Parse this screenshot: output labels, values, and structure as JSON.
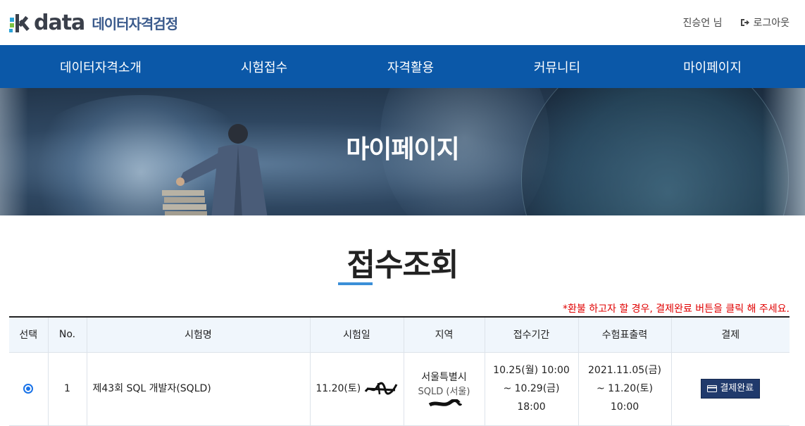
{
  "header": {
    "logo_text": "data",
    "logo_subtitle": "데이터자격검정",
    "user_name": "진승언 님",
    "logout_label": "로그아웃"
  },
  "nav": {
    "items": [
      {
        "label": "데이터자격소개"
      },
      {
        "label": "시험접수"
      },
      {
        "label": "자격활용"
      },
      {
        "label": "커뮤니티"
      },
      {
        "label": "마이페이지"
      }
    ]
  },
  "banner": {
    "title": "마이페이지"
  },
  "page": {
    "title": "접수조회",
    "notice": "*환불 하고자 할 경우, 결제완료 버튼을 클릭 해 주세요."
  },
  "table": {
    "headers": [
      "선택",
      "No.",
      "시험명",
      "시험일",
      "지역",
      "접수기간",
      "수험표출력",
      "결제"
    ],
    "rows": [
      {
        "selected": true,
        "no": "1",
        "exam_name": "제43회 SQL 개발자(SQLD)",
        "exam_date": "11.20(토)",
        "region": "서울특별시",
        "region_sub": "SQLD (서울)",
        "period_line1": "10.25(월) 10:00",
        "period_line2": "~ 10.29(금)",
        "period_line3": "18:00",
        "ticket_line1": "2021.11.05(금)",
        "ticket_line2": "~ 11.20(토)",
        "ticket_line3": "10:00",
        "payment_label": "결제완료"
      }
    ]
  },
  "colors": {
    "nav_bg": "#0b58a8",
    "accent_underline": "#3b8fd8",
    "notice_red": "#e00000",
    "pay_button": "#203a6c",
    "table_header_bg": "#f0f6fc"
  },
  "icons": {
    "logout": "sign-out-icon",
    "payment": "credit-card-icon",
    "logo": "k-logo-icon"
  }
}
